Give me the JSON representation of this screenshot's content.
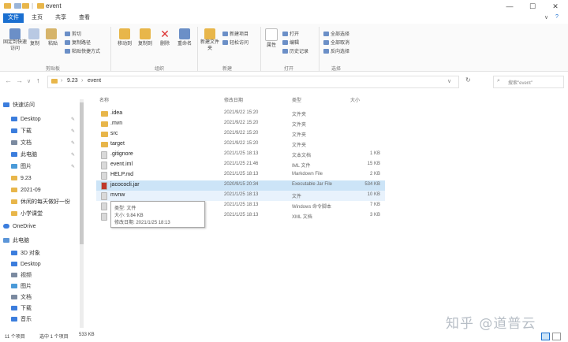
{
  "window": {
    "title": "event",
    "quick_access_divider": "|",
    "min": "—",
    "max": "☐",
    "close": "✕",
    "help": "?",
    "expand": "∨"
  },
  "tabs": [
    "文件",
    "主页",
    "共享",
    "查看"
  ],
  "ribbon": {
    "clipboard": {
      "pin": "固定到快速访问",
      "copy": "复制",
      "paste": "粘贴",
      "cut": "剪切",
      "copy_path": "复制路径",
      "paste_shortcut": "粘贴快捷方式",
      "group": "剪贴板"
    },
    "organize": {
      "move_to": "移动到",
      "copy_to": "复制到",
      "delete": "删除",
      "rename": "重命名",
      "group": "组织"
    },
    "new": {
      "new_folder": "新建文件夹",
      "new_item": "新建项目",
      "easy_access": "轻松访问",
      "group": "新建"
    },
    "open": {
      "properties": "属性",
      "open": "打开",
      "edit": "编辑",
      "history": "历史记录",
      "group": "打开"
    },
    "select": {
      "select_all": "全部选择",
      "select_none": "全部取消",
      "invert": "反向选择",
      "group": "选择"
    }
  },
  "address": {
    "crumbs": [
      "9.23",
      "event"
    ],
    "search_placeholder": "搜索\"event\""
  },
  "nav": {
    "quick_access": "快速访问",
    "items": [
      {
        "label": "Desktop",
        "pinned": true,
        "color": "#3b7ddd"
      },
      {
        "label": "下载",
        "pinned": true,
        "color": "#3b7ddd"
      },
      {
        "label": "文档",
        "pinned": true,
        "color": "#7b8aa0"
      },
      {
        "label": "此电脑",
        "pinned": true,
        "color": "#3b7ddd"
      },
      {
        "label": "图片",
        "pinned": true,
        "color": "#4a9ad8"
      },
      {
        "label": "9.23",
        "pinned": false,
        "color": "#e8b64a"
      },
      {
        "label": "2021-09",
        "pinned": false,
        "color": "#e8b64a"
      },
      {
        "label": "休闲的每天做好一份",
        "pinned": false,
        "color": "#e8b64a"
      },
      {
        "label": "小学课堂",
        "pinned": false,
        "color": "#e8b64a"
      }
    ],
    "onedrive": "OneDrive",
    "this_pc": "此电脑",
    "pc_items": [
      {
        "label": "3D 对象",
        "color": "#3b7ddd"
      },
      {
        "label": "Desktop",
        "color": "#3b7ddd"
      },
      {
        "label": "视频",
        "color": "#7b8aa0"
      },
      {
        "label": "图片",
        "color": "#4a9ad8"
      },
      {
        "label": "文档",
        "color": "#7b8aa0"
      },
      {
        "label": "下载",
        "color": "#3b7ddd"
      },
      {
        "label": "音乐",
        "color": "#3b7ddd"
      }
    ]
  },
  "columns": {
    "name": "名称",
    "date": "修改日期",
    "type": "类型",
    "size": "大小"
  },
  "files": [
    {
      "name": ".idea",
      "date": "2021/9/22 15:20",
      "type": "文件夹",
      "size": "",
      "kind": "folder"
    },
    {
      "name": ".mvn",
      "date": "2021/9/22 15:20",
      "type": "文件夹",
      "size": "",
      "kind": "folder"
    },
    {
      "name": "src",
      "date": "2021/9/22 15:20",
      "type": "文件夹",
      "size": "",
      "kind": "folder"
    },
    {
      "name": "target",
      "date": "2021/9/22 15:20",
      "type": "文件夹",
      "size": "",
      "kind": "folder"
    },
    {
      "name": ".gitignore",
      "date": "2021/1/25 18:13",
      "type": "文本文档",
      "size": "1 KB",
      "kind": "file"
    },
    {
      "name": "event.iml",
      "date": "2021/1/25 21:46",
      "type": "IML 文件",
      "size": "15 KB",
      "kind": "file"
    },
    {
      "name": "HELP.md",
      "date": "2021/1/25 18:13",
      "type": "Markdown File",
      "size": "2 KB",
      "kind": "file"
    },
    {
      "name": "jacococli.jar",
      "date": "2020/9/15 20:34",
      "type": "Executable Jar File",
      "size": "534 KB",
      "kind": "jar"
    },
    {
      "name": "mvnw",
      "date": "2021/1/25 18:13",
      "type": "文件",
      "size": "10 KB",
      "kind": "file"
    },
    {
      "name": "mvnw.cmd",
      "date": "2021/1/25 18:13",
      "type": "Windows 命令脚本",
      "size": "7 KB",
      "kind": "file"
    },
    {
      "name": "pom.xml",
      "date": "2021/1/25 18:13",
      "type": "XML 文档",
      "size": "3 KB",
      "kind": "file"
    }
  ],
  "tooltip": {
    "type": "类型: 文件",
    "size": "大小: 9.84 KB",
    "modified": "修改日期: 2021/1/25 18:13"
  },
  "status": {
    "count": "11 个项目",
    "selected": "选中 1 个项目",
    "size": "533 KB"
  },
  "watermark": "知乎 @道普云"
}
